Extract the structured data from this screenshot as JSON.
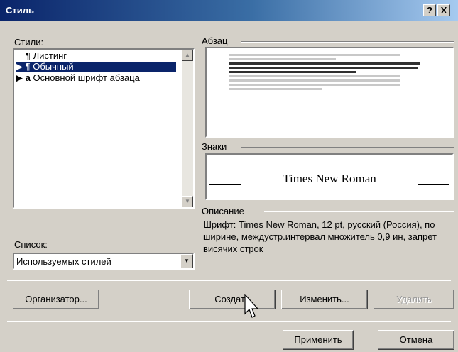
{
  "window": {
    "title": "Стиль",
    "help_label": "?",
    "close_label": "X"
  },
  "styles": {
    "label": "Стили:",
    "items": [
      {
        "marker": "¶",
        "label": "Листинг",
        "selected": false
      },
      {
        "marker": "¶",
        "label": "Обычный",
        "selected": true
      },
      {
        "marker": "a",
        "label": "Основной шрифт абзаца",
        "selected": false
      }
    ]
  },
  "list_filter": {
    "label": "Список:",
    "value": "Используемых стилей"
  },
  "paragraph": {
    "label": "Абзац"
  },
  "chars": {
    "label": "Знаки",
    "font_sample": "Times New Roman"
  },
  "description": {
    "label": "Описание",
    "text": "Шрифт: Times New Roman, 12 pt, русский (Россия), по ширине, междустр.интервал множитель 0,9 ин, запрет висячих строк"
  },
  "buttons": {
    "organizer": "Организатор...",
    "create": "Создать",
    "modify": "Изменить...",
    "delete": "Удалить",
    "apply": "Применить",
    "cancel": "Отмена"
  }
}
